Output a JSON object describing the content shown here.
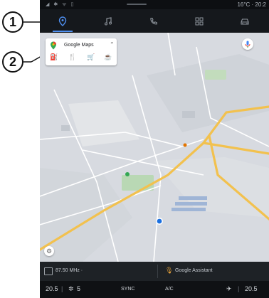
{
  "callouts": {
    "one": "1",
    "two": "2"
  },
  "status_bar": {
    "temperature_time": "16°C · 20:2"
  },
  "nav": {
    "items": [
      {
        "icon": "navigation-pin-icon",
        "active": true
      },
      {
        "icon": "music-note-icon",
        "active": false
      },
      {
        "icon": "phone-icon",
        "active": false
      },
      {
        "icon": "apps-grid-icon",
        "active": false
      },
      {
        "icon": "car-icon",
        "active": false
      }
    ]
  },
  "search_card": {
    "title": "Google Maps",
    "categories": [
      {
        "icon": "gas-station-icon"
      },
      {
        "icon": "restaurant-icon"
      },
      {
        "icon": "shopping-cart-icon"
      },
      {
        "icon": "coffee-icon"
      }
    ]
  },
  "media": {
    "radio": "87.50 MHz ·",
    "assistant": "Google Assistant"
  },
  "climate": {
    "left_temp": "20.5",
    "fan": "5",
    "sync": "SYNC",
    "ac": "A/C",
    "right_temp": "20.5"
  },
  "colors": {
    "accent": "#4e8ff0",
    "road_major": "#f2c14e",
    "map_bg": "#d7dae0"
  }
}
